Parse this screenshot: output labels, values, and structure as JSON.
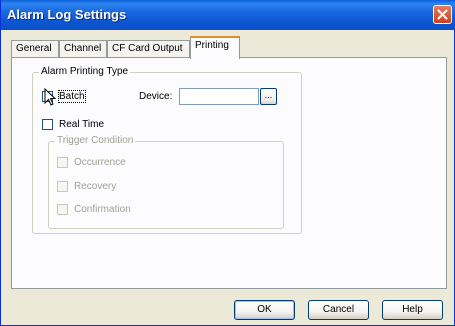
{
  "window": {
    "title": "Alarm Log Settings",
    "close_icon": "close-icon"
  },
  "tabs": [
    {
      "label": "General"
    },
    {
      "label": "Channel"
    },
    {
      "label": "CF Card Output"
    },
    {
      "label": "Printing",
      "active": true
    }
  ],
  "printing": {
    "group_title": "Alarm Printing Type",
    "batch_label": "Batch",
    "batch_checked": false,
    "device_label": "Device:",
    "device_value": "",
    "browse_label": "...",
    "realtime_label": "Real Time",
    "realtime_checked": false,
    "trigger": {
      "group_title": "Trigger Condition",
      "occurrence_label": "Occurrence",
      "recovery_label": "Recovery",
      "confirmation_label": "Confirmation"
    }
  },
  "buttons": {
    "ok": "OK",
    "cancel": "Cancel",
    "help": "Help"
  },
  "colors": {
    "title_bar": "#0a5fd9",
    "active_tab_accent": "#e68b2c",
    "dialog_bg": "#ece9d8"
  }
}
